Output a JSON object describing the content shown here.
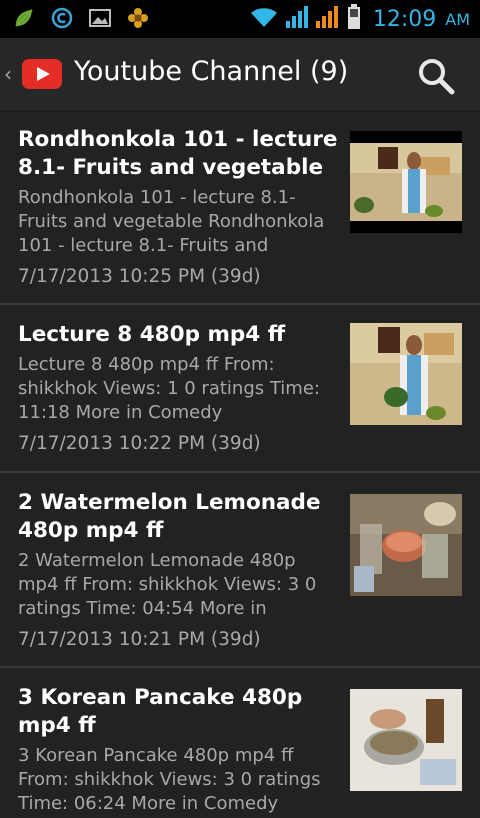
{
  "status_bar": {
    "time": "12:09",
    "ampm": "AM",
    "icons": [
      "leaf-icon",
      "sync-icon",
      "image-icon",
      "flower-icon",
      "wifi-icon",
      "signal-icon",
      "signal-icon",
      "battery-icon"
    ]
  },
  "action_bar": {
    "title": "Youtube Channel (9)",
    "logo": "youtube-logo",
    "search_icon": "search-icon"
  },
  "videos": [
    {
      "title": "Rondhonkola 101 - lecture 8.1- Fruits and vegetable",
      "description": "Rondhonkola 101 - lecture 8.1- Fruits and vegetable Rondhonkola 101 - lecture 8.1- Fruits and",
      "date": "7/17/2013 10:25 PM (39d)"
    },
    {
      "title": "Lecture 8 480p mp4 ff",
      "description": "Lecture 8 480p mp4 ff From: shikkhok Views: 1 0 ratings Time: 11:18 More in Comedy",
      "date": "7/17/2013 10:22 PM (39d)"
    },
    {
      "title": "2 Watermelon Lemonade 480p mp4 ff",
      "description": "2 Watermelon Lemonade 480p mp4 ff From: shikkhok Views: 3 0 ratings Time: 04:54 More in",
      "date": "7/17/2013 10:21 PM (39d)"
    },
    {
      "title": "3 Korean Pancake 480p mp4 ff",
      "description": "3 Korean Pancake 480p mp4 ff From: shikkhok Views: 3 0 ratings Time: 06:24 More in Comedy",
      "date": ""
    }
  ],
  "colors": {
    "accent": "#33b5e5",
    "background": "#222222",
    "youtube_red": "#e52d27"
  }
}
